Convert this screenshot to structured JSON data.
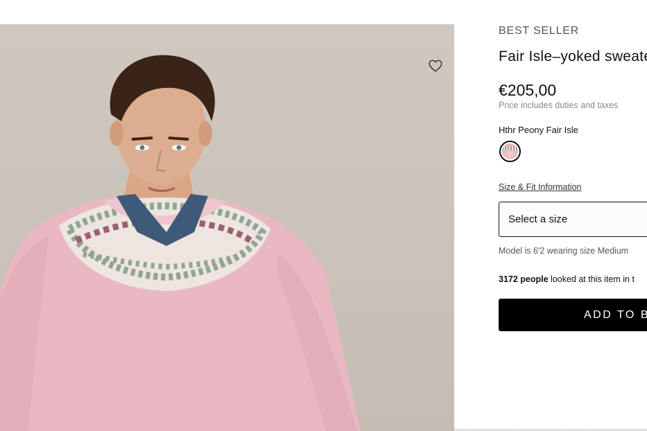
{
  "product": {
    "badge": "BEST SELLER",
    "title": "Fair Isle–yoked sweate",
    "price": "€205,00",
    "price_note": "Price includes duties and taxes",
    "color_name": "Hthr Peony Fair Isle",
    "size_fit_link": "Size & Fit Information",
    "size_select_placeholder": "Select a size",
    "model_note": "Model is 6'2 wearing size Medium",
    "views_count": "3172 people",
    "views_text": " looked at this item in t",
    "add_to_bag": "ADD TO BA"
  },
  "icons": {
    "wishlist": "heart-outline-icon"
  },
  "colors": {
    "background": "#ffffff",
    "button": "#000000",
    "sweater": "#e9b9c4",
    "photo_backdrop": "#cbc4bb"
  }
}
